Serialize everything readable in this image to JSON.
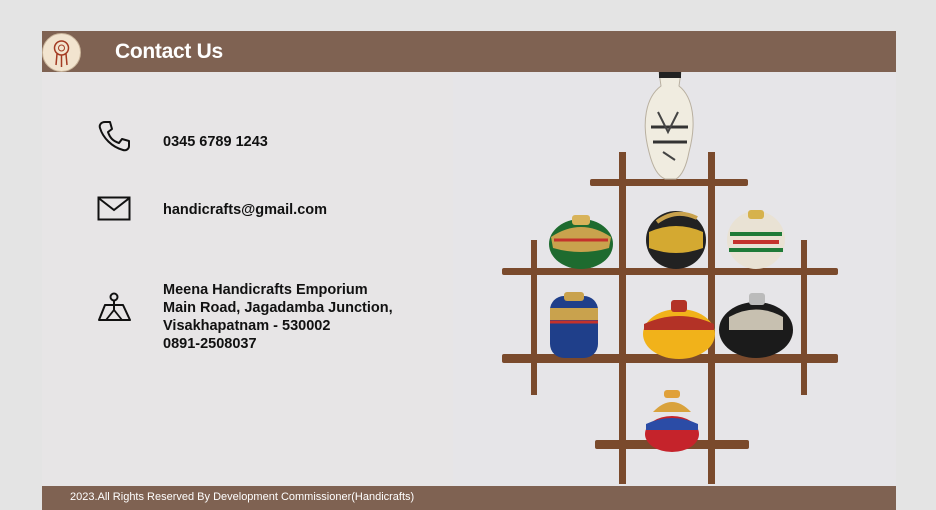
{
  "header": {
    "title": "Contact Us",
    "logo_icon": "dreamcatcher-logo-icon"
  },
  "contact": {
    "phone": {
      "icon": "phone-icon",
      "value": "0345 6789 1243"
    },
    "email": {
      "icon": "mail-icon",
      "value": "handicrafts@gmail.com"
    },
    "address": {
      "icon": "map-pin-icon",
      "lines": [
        "Meena Handicrafts Emporium",
        "Main Road, Jagadamba Junction,",
        "Visakhapatnam - 530002",
        "0891-2508037"
      ]
    }
  },
  "footer": {
    "text": "2023.All Rights Reserved By Development Commissioner(Handicrafts)"
  },
  "colors": {
    "brand": "#7f6252",
    "panel": "#e7e5e6"
  }
}
